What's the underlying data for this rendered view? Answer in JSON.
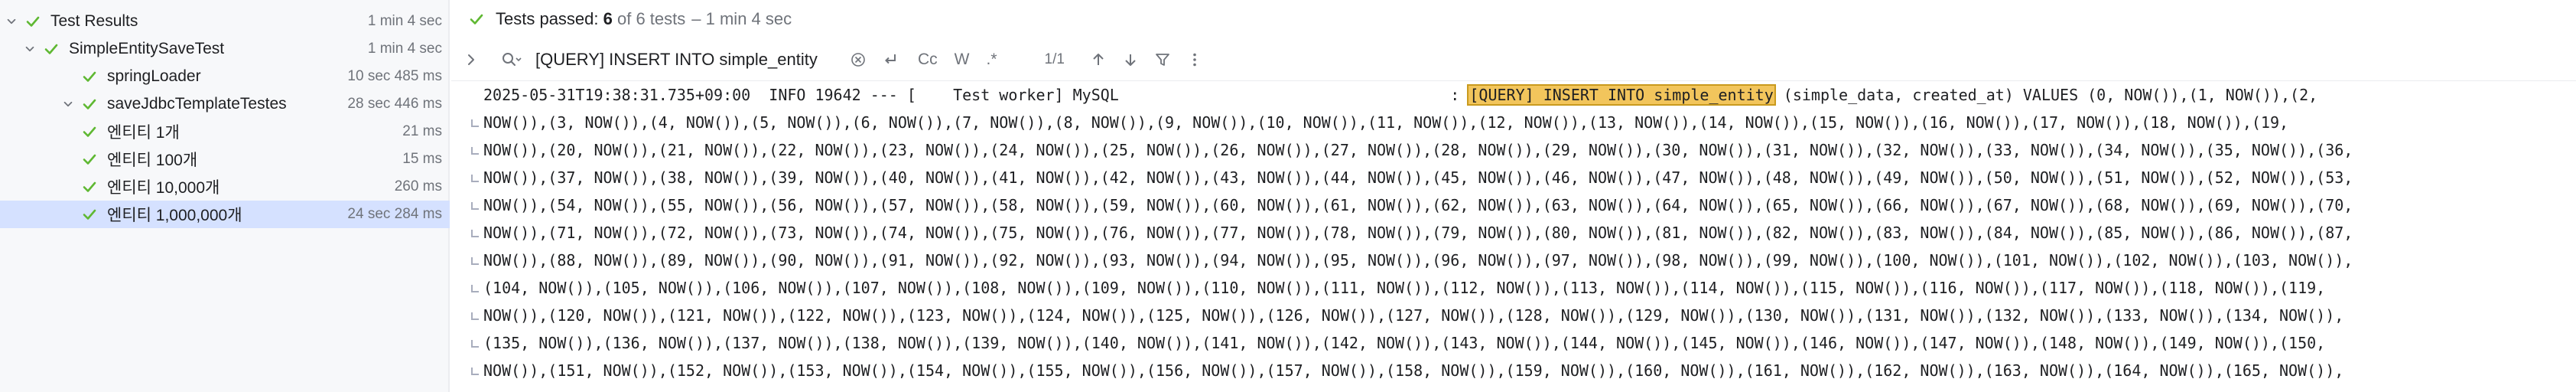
{
  "colors": {
    "pass": "#5fb832",
    "highlight": "#f2c55c",
    "selection": "#d5e1ff"
  },
  "tree": [
    {
      "label": "Test Results",
      "time": "1 min 4 sec",
      "indent": 0,
      "expanded": true
    },
    {
      "label": "SimpleEntitySaveTest",
      "time": "1 min 4 sec",
      "indent": 1,
      "expanded": true
    },
    {
      "label": "springLoader",
      "time": "10 sec 485 ms",
      "indent": 2,
      "expanded": false
    },
    {
      "label": "saveJdbcTemplateTestes",
      "time": "28 sec 446 ms",
      "indent": 2,
      "expanded": true
    },
    {
      "label": "엔티티 1개",
      "time": "21 ms",
      "indent": 3,
      "expanded": false
    },
    {
      "label": "엔티티 100개",
      "time": "15 ms",
      "indent": 3,
      "expanded": false
    },
    {
      "label": "엔티티 10,000개",
      "time": "260 ms",
      "indent": 3,
      "expanded": false
    },
    {
      "label": "엔티티 1,000,000개",
      "time": "24 sec 284 ms",
      "indent": 3,
      "expanded": false,
      "selected": true
    }
  ],
  "status": {
    "prefix": "Tests passed: ",
    "passed_count": "6",
    "suffix": " of 6 tests",
    "duration": "– 1 min 4 sec"
  },
  "search": {
    "value": "[QUERY] INSERT INTO simple_entity",
    "match_case": "Cc",
    "words": "W",
    "regex": ".*",
    "match_count": "1/1"
  },
  "icons": {
    "chevron_expanded": "chevron-down-icon",
    "chevron_right": "chevron-right-icon",
    "check": "check-icon",
    "search": "search-history-icon",
    "clear": "clear-icon",
    "newline": "newline-icon",
    "prev": "arrow-up-icon",
    "next": "arrow-down-icon",
    "filter": "filter-icon",
    "more": "more-icon"
  },
  "console": {
    "first_prefix": "2025-05-31T19:38:31.735+09:00  INFO 19642 --- [    Test worker] MySQL                                    : ",
    "highlight": "[QUERY] INSERT INTO simple_entity",
    "first_suffix": " (simple_data, created_at) VALUES (0, NOW()),(1, NOW()),(2,",
    "lines": [
      "NOW()),(3, NOW()),(4, NOW()),(5, NOW()),(6, NOW()),(7, NOW()),(8, NOW()),(9, NOW()),(10, NOW()),(11, NOW()),(12, NOW()),(13, NOW()),(14, NOW()),(15, NOW()),(16, NOW()),(17, NOW()),(18, NOW()),(19,",
      "NOW()),(20, NOW()),(21, NOW()),(22, NOW()),(23, NOW()),(24, NOW()),(25, NOW()),(26, NOW()),(27, NOW()),(28, NOW()),(29, NOW()),(30, NOW()),(31, NOW()),(32, NOW()),(33, NOW()),(34, NOW()),(35, NOW()),(36,",
      "NOW()),(37, NOW()),(38, NOW()),(39, NOW()),(40, NOW()),(41, NOW()),(42, NOW()),(43, NOW()),(44, NOW()),(45, NOW()),(46, NOW()),(47, NOW()),(48, NOW()),(49, NOW()),(50, NOW()),(51, NOW()),(52, NOW()),(53,",
      "NOW()),(54, NOW()),(55, NOW()),(56, NOW()),(57, NOW()),(58, NOW()),(59, NOW()),(60, NOW()),(61, NOW()),(62, NOW()),(63, NOW()),(64, NOW()),(65, NOW()),(66, NOW()),(67, NOW()),(68, NOW()),(69, NOW()),(70,",
      "NOW()),(71, NOW()),(72, NOW()),(73, NOW()),(74, NOW()),(75, NOW()),(76, NOW()),(77, NOW()),(78, NOW()),(79, NOW()),(80, NOW()),(81, NOW()),(82, NOW()),(83, NOW()),(84, NOW()),(85, NOW()),(86, NOW()),(87,",
      "NOW()),(88, NOW()),(89, NOW()),(90, NOW()),(91, NOW()),(92, NOW()),(93, NOW()),(94, NOW()),(95, NOW()),(96, NOW()),(97, NOW()),(98, NOW()),(99, NOW()),(100, NOW()),(101, NOW()),(102, NOW()),(103, NOW()),",
      "(104, NOW()),(105, NOW()),(106, NOW()),(107, NOW()),(108, NOW()),(109, NOW()),(110, NOW()),(111, NOW()),(112, NOW()),(113, NOW()),(114, NOW()),(115, NOW()),(116, NOW()),(117, NOW()),(118, NOW()),(119,",
      "NOW()),(120, NOW()),(121, NOW()),(122, NOW()),(123, NOW()),(124, NOW()),(125, NOW()),(126, NOW()),(127, NOW()),(128, NOW()),(129, NOW()),(130, NOW()),(131, NOW()),(132, NOW()),(133, NOW()),(134, NOW()),",
      "(135, NOW()),(136, NOW()),(137, NOW()),(138, NOW()),(139, NOW()),(140, NOW()),(141, NOW()),(142, NOW()),(143, NOW()),(144, NOW()),(145, NOW()),(146, NOW()),(147, NOW()),(148, NOW()),(149, NOW()),(150,",
      "NOW()),(151, NOW()),(152, NOW()),(153, NOW()),(154, NOW()),(155, NOW()),(156, NOW()),(157, NOW()),(158, NOW()),(159, NOW()),(160, NOW()),(161, NOW()),(162, NOW()),(163, NOW()),(164, NOW()),(165, NOW()),"
    ]
  }
}
